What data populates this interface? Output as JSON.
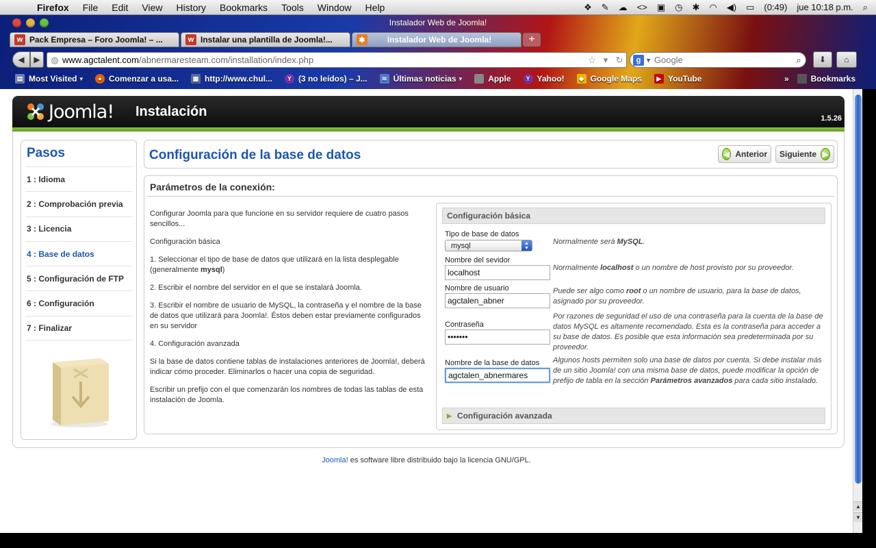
{
  "menubar": {
    "app": "Firefox",
    "items": [
      "File",
      "Edit",
      "View",
      "History",
      "Bookmarks",
      "Tools",
      "Window",
      "Help"
    ],
    "battery": "(0:49)",
    "clock": "jue 10:18 p.m."
  },
  "window": {
    "title": "Instalador Web de Joomla!"
  },
  "tabs": [
    {
      "label": "Pack Empresa – Foro Joomla! – ...",
      "favicon_color": "#c0392b"
    },
    {
      "label": "Instalar una plantilla de Joomla!...",
      "favicon_color": "#c0392b"
    },
    {
      "label": "Instalador Web de Joomla!",
      "favicon_color": "#e67e22"
    }
  ],
  "navbar": {
    "url_host": "www.agctalent.com",
    "url_path": "/abnermaresteam.com/installation/index.php",
    "search_placeholder": "Google"
  },
  "bookmarks": {
    "items": [
      {
        "label": "Most Visited",
        "icon_color": "#6a7fb8",
        "chevron": true
      },
      {
        "label": "Comenzar a usa...",
        "icon_color": "#e66000",
        "chevron": false
      },
      {
        "label": "http://www.chul...",
        "icon_color": "#5a6b9a",
        "chevron": false
      },
      {
        "label": "(3 no leídos) – J...",
        "icon_color": "#7b2fa8",
        "chevron": false
      },
      {
        "label": "Últimas noticias",
        "icon_color": "#4a7bd4",
        "chevron": true
      },
      {
        "label": "Apple",
        "icon_color": "#888888",
        "chevron": false
      },
      {
        "label": "Yahoo!",
        "icon_color": "#7b2fa8",
        "chevron": false
      },
      {
        "label": "Google Maps",
        "icon_color": "#e6b800",
        "chevron": false
      },
      {
        "label": "YouTube",
        "icon_color": "#cc0000",
        "chevron": false
      }
    ],
    "right_label": "Bookmarks"
  },
  "joomla": {
    "logo_text": "Joomla!",
    "header_title": "Instalación",
    "version": "1.5.26"
  },
  "steps": {
    "title": "Pasos",
    "items": [
      "1 : Idioma",
      "2 : Comprobación previa",
      "3 : Licencia",
      "4 : Base de datos",
      "5 : Configuración de FTP",
      "6 : Configuración",
      "7 : Finalizar"
    ],
    "current_index": 3
  },
  "main": {
    "title": "Configuración de la base de datos",
    "prev_label": "Anterior",
    "next_label": "Siguiente"
  },
  "connection": {
    "title": "Parámetros de la conexión:",
    "instructions": {
      "p1": "Configurar Joomla para que funcione en su servidor requiere de cuatro pasos sencillos...",
      "p2": "Configuración básica",
      "p3_a": "1. Seleccionar el tipo de base de datos que utilizará en la lista desplegable (generalmente ",
      "p3_b": "mysql",
      "p3_c": ")",
      "p4": "2. Escribir el nombre del servidor en el que se instalará Joomla.",
      "p5": "3. Escribir el nombre de usuario de MySQL, la contraseña y el nombre de la base de datos que utilizará para Joomla!. Éstos deben estar previamente configurados en su servidor",
      "p6": "4. Configuración avanzada",
      "p7": "Si la base de datos contiene tablas de instalaciones anteriores de Joomla!, deberá indicar cómo proceder. Eliminarlos o hacer una copia de seguridad.",
      "p8": "Escribir un prefijo con el que comenzarán los nombres de todas las tablas de esta instalación de Joomla."
    }
  },
  "config": {
    "basic_title": "Configuración básica",
    "advanced_title": "Configuración avanzada",
    "db_type": {
      "label": "Tipo de base de datos",
      "value": "mysql",
      "help_a": "Normalmente será ",
      "help_b": "MySQL",
      "help_c": "."
    },
    "server": {
      "label": "Nombre del sevidor",
      "value": "localhost",
      "help_a": "Normalmente ",
      "help_b": "localhost",
      "help_c": " o un nombre de host provisto por su proveedor."
    },
    "username": {
      "label": "Nombre de usuario",
      "value": "agctalen_abner",
      "help_a": "Puede ser algo como ",
      "help_b": "root",
      "help_c": " o un nombre de usuario, para la base de datos, asignado por su proveedor."
    },
    "password": {
      "label": "Contraseña",
      "value": "•••••••",
      "help": "Por razones de seguridad el uso de una contraseña para la cuenta de la base de datos MySQL es altamente recomendado. Esta es la contraseña para acceder a su base de datos. Es posible que esta información sea predeterminada por su proveedor."
    },
    "dbname": {
      "label": "Nombre de la base de datos",
      "value": "agctalen_abnermares",
      "help_a": "Algunos hosts permiten solo una base de datos por cuenta. Si debe instalar más de un sitio Joomla! con una misma base de datos, puede modificar la opción de prefijo de tabla en la sección ",
      "help_b": "Parámetros avanzados",
      "help_c": " para cada sitio instalado."
    }
  },
  "footer": {
    "link": "Joomla!",
    "text": " es software libre distribuido bajo la licencia GNU/GPL."
  },
  "colors": {
    "joomla_blue": "#1b57b1",
    "joomla_green": "#8cc63f",
    "header_black": "#111111"
  }
}
